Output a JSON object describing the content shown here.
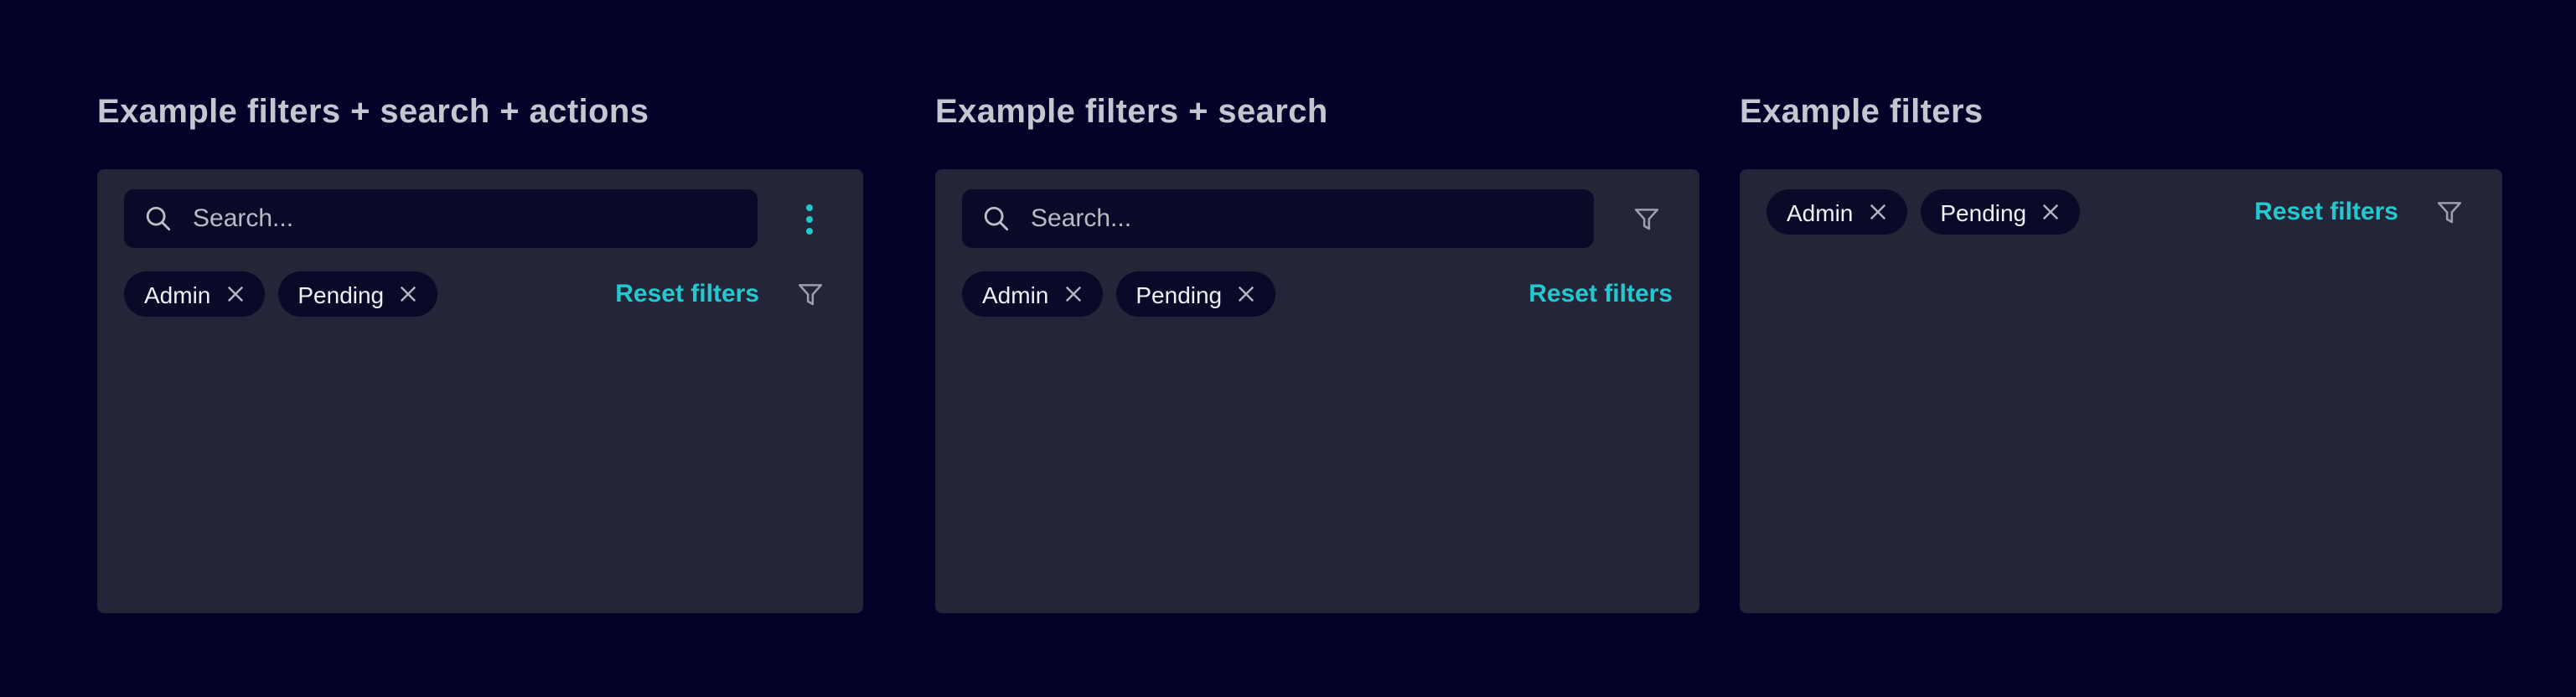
{
  "colors": {
    "page_background": "#030128",
    "panel_background": "#252539",
    "field_background": "#0a0a28",
    "accent_teal": "#22c9ce",
    "title_text": "#c6c6d1",
    "chip_text": "#eef0f5",
    "icon_gray": "#9aa0ad"
  },
  "icons": {
    "search": "magnifier-icon",
    "kebab": "vertical-dots-menu-icon",
    "filter": "funnel-icon",
    "chip_remove": "x-close-icon"
  },
  "sections": [
    {
      "title": "Example filters + search + actions",
      "search_placeholder": "Search...",
      "search_value": "",
      "chips": [
        {
          "label": "Admin"
        },
        {
          "label": "Pending"
        }
      ],
      "reset_label": "Reset filters"
    },
    {
      "title": "Example filters + search",
      "search_placeholder": "Search...",
      "search_value": "",
      "chips": [
        {
          "label": "Admin"
        },
        {
          "label": "Pending"
        }
      ],
      "reset_label": "Reset filters"
    },
    {
      "title": "Example filters",
      "chips": [
        {
          "label": "Admin"
        },
        {
          "label": "Pending"
        }
      ],
      "reset_label": "Reset filters"
    }
  ]
}
